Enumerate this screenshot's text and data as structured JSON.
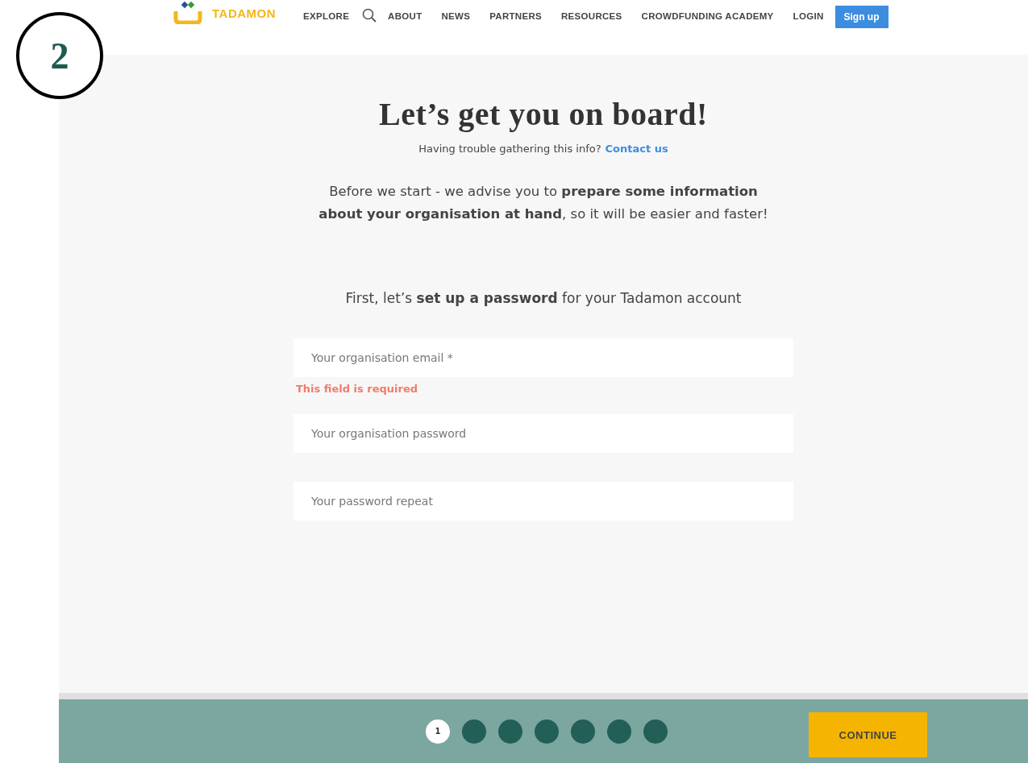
{
  "annotation": {
    "number": "2"
  },
  "header": {
    "logo": "TADAMON",
    "nav": [
      "EXPLORE",
      "ABOUT",
      "NEWS",
      "PARTNERS",
      "RESOURCES",
      "CROWDFUNDING ACADEMY",
      "LOGIN"
    ],
    "signup": "Sign up"
  },
  "title": "Let’s get you on board!",
  "help": {
    "text": "Having trouble gathering this info?",
    "link": "Contact us"
  },
  "intro": "Before we start - we advise you to **prepare some information about your organisation at hand**, so it will be easier and faster!",
  "password_intro": "First, let’s **set up a password** for your Tadamon account",
  "fields": [
    {
      "placeholder": "Your organisation email *",
      "error": "This field is required"
    },
    {
      "placeholder": "Your organisation password"
    },
    {
      "placeholder": "Your password repeat"
    }
  ],
  "steps": [
    {
      "label": "1",
      "selected": true
    },
    {
      "selected": false
    },
    {
      "selected": false
    },
    {
      "selected": false
    },
    {
      "selected": false
    },
    {
      "selected": false
    },
    {
      "selected": false
    }
  ],
  "continue": "CONTINUE"
}
